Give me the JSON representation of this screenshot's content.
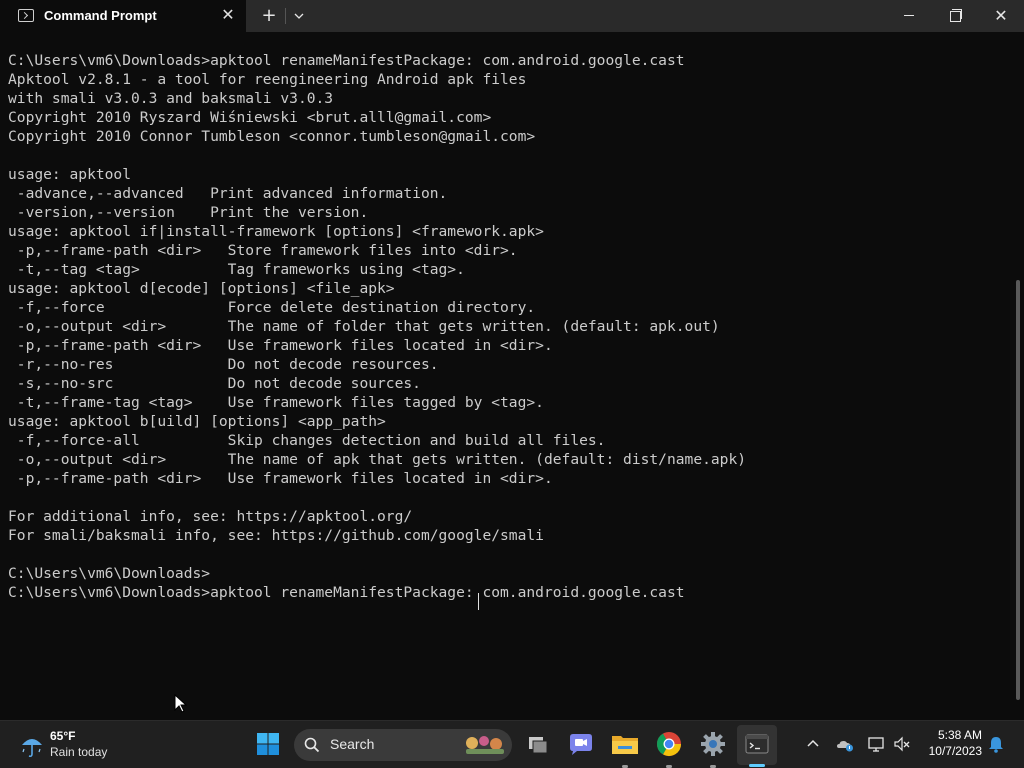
{
  "window": {
    "tab_title": "Command Prompt",
    "tab_close_glyph": "✕",
    "new_tab_glyph": "+",
    "dropdown_glyph": "⌄",
    "close_glyph": "✕"
  },
  "terminal": {
    "lines": [
      "",
      "C:\\Users\\vm6\\Downloads>apktool renameManifestPackage: com.android.google.cast",
      "Apktool v2.8.1 - a tool for reengineering Android apk files",
      "with smali v3.0.3 and baksmali v3.0.3",
      "Copyright 2010 Ryszard Wiśniewski <brut.alll@gmail.com>",
      "Copyright 2010 Connor Tumbleson <connor.tumbleson@gmail.com>",
      "",
      "usage: apktool",
      " -advance,--advanced   Print advanced information.",
      " -version,--version    Print the version.",
      "usage: apktool if|install-framework [options] <framework.apk>",
      " -p,--frame-path <dir>   Store framework files into <dir>.",
      " -t,--tag <tag>          Tag frameworks using <tag>.",
      "usage: apktool d[ecode] [options] <file_apk>",
      " -f,--force              Force delete destination directory.",
      " -o,--output <dir>       The name of folder that gets written. (default: apk.out)",
      " -p,--frame-path <dir>   Use framework files located in <dir>.",
      " -r,--no-res             Do not decode resources.",
      " -s,--no-src             Do not decode sources.",
      " -t,--frame-tag <tag>    Use framework files tagged by <tag>.",
      "usage: apktool b[uild] [options] <app_path>",
      " -f,--force-all          Skip changes detection and build all files.",
      " -o,--output <dir>       The name of apk that gets written. (default: dist/name.apk)",
      " -p,--frame-path <dir>   Use framework files located in <dir>.",
      "",
      "For additional info, see: https://apktool.org/",
      "For smali/baksmali info, see: https://github.com/google/smali",
      "",
      "C:\\Users\\vm6\\Downloads>",
      "C:\\Users\\vm6\\Downloads>apktool renameManifestPackage: com.android.google.cast"
    ]
  },
  "taskbar": {
    "weather_temp": "65°F",
    "weather_desc": "Rain today",
    "search_label": "Search",
    "clock_time": "5:38 AM",
    "clock_date": "10/7/2023"
  },
  "icons": {
    "weather": "rain-umbrella-icon",
    "start": "windows-start-icon",
    "search": "search-icon",
    "task_view": "task-view-icon",
    "chat": "teams-chat-icon",
    "explorer": "file-explorer-icon",
    "chrome": "chrome-icon",
    "settings": "settings-gear-icon",
    "terminal": "terminal-icon"
  },
  "colors": {
    "terminal_bg": "#0c0c0c",
    "terminal_fg": "#cccccc",
    "titlebar_bg": "#2a2a2a",
    "taskbar_bg": "#202020",
    "accent": "#60cdff"
  }
}
